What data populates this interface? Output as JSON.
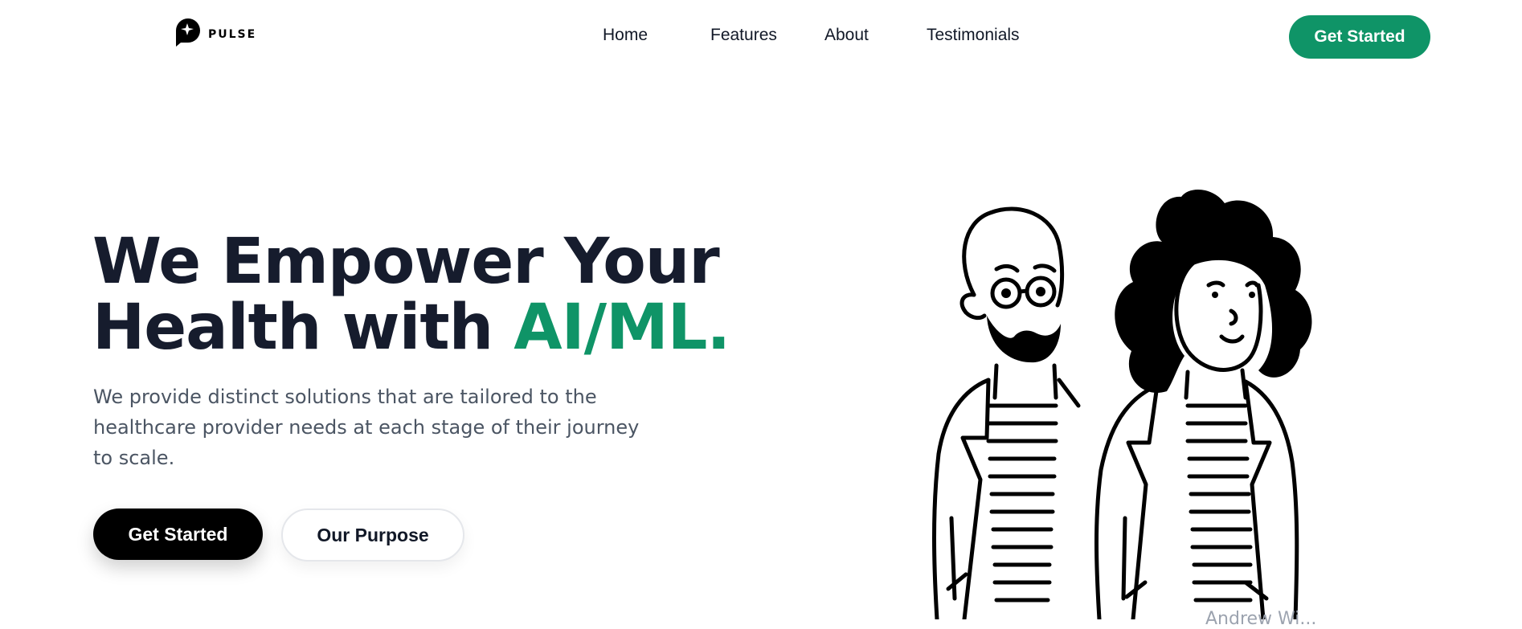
{
  "brand": {
    "name": "PULSE"
  },
  "nav": {
    "links": [
      "Home",
      "Features",
      "About",
      "Testimonials"
    ],
    "cta": "Get Started"
  },
  "hero": {
    "title_line1": "We Empower Your",
    "title_line2_prefix": "Health with ",
    "title_accent": "AI/ML.",
    "description": "We provide distinct solutions that are tailored to the healthcare provider needs at each stage of their journey to scale.",
    "primary_button": "Get Started",
    "secondary_button": "Our Purpose"
  },
  "illustration": {
    "credit": "Andrew Wi..."
  },
  "colors": {
    "accent": "#0f9467",
    "heading": "#161c2d",
    "body": "#4b5563",
    "primary_button": "#000000"
  },
  "icons": [
    "logo-icon"
  ]
}
